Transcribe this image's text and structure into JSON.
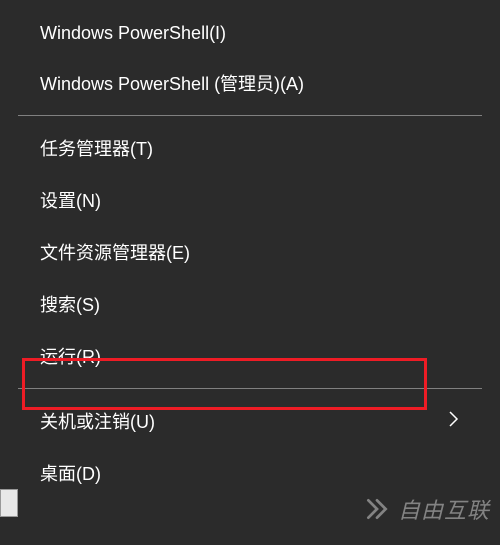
{
  "menu": {
    "group1": [
      {
        "label": "Windows PowerShell(I)"
      },
      {
        "label": "Windows PowerShell (管理员)(A)"
      }
    ],
    "group2": [
      {
        "label": "任务管理器(T)"
      },
      {
        "label": "设置(N)"
      },
      {
        "label": "文件资源管理器(E)"
      },
      {
        "label": "搜索(S)"
      },
      {
        "label": "运行(R)"
      }
    ],
    "group3": [
      {
        "label": "关机或注销(U)",
        "has_submenu": true
      },
      {
        "label": "桌面(D)"
      }
    ]
  },
  "highlight_index": 4,
  "watermark": {
    "text": "自由互联"
  }
}
